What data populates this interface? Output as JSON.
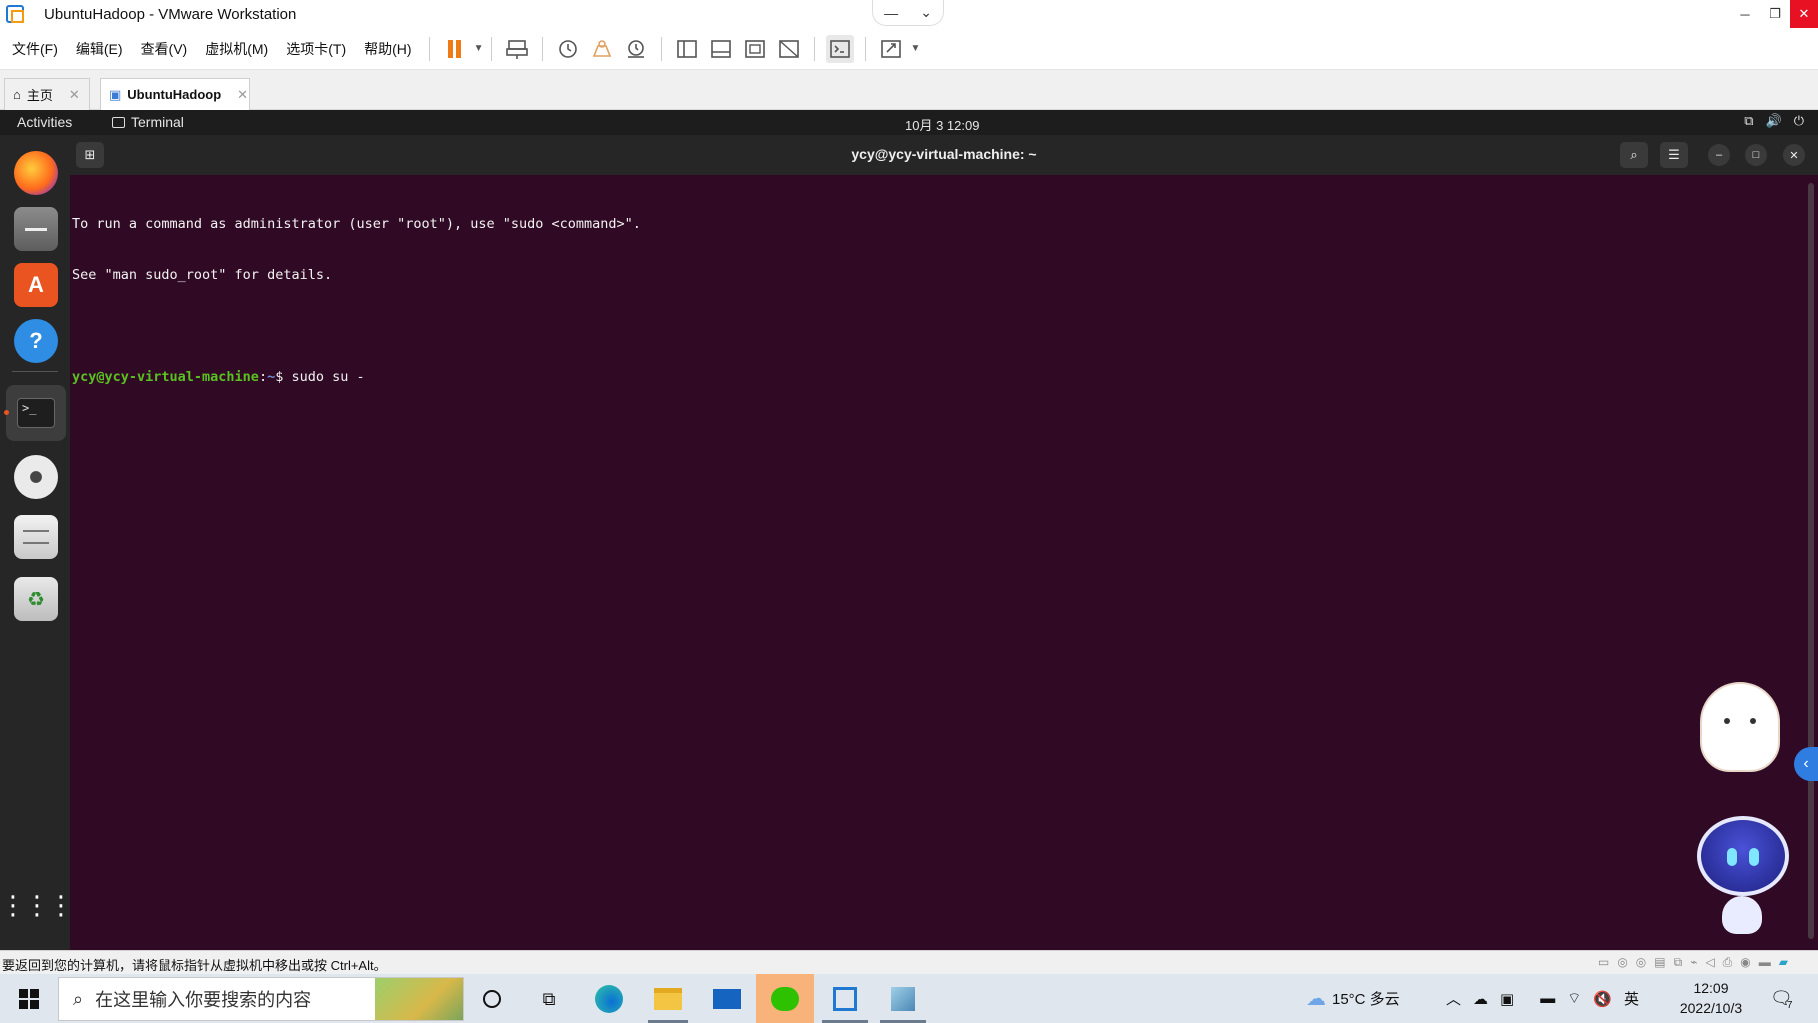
{
  "window": {
    "title": "UbuntuHadoop - VMware Workstation",
    "min_glyph": "─",
    "restore_glyph": "❐",
    "close_glyph": "✕",
    "center_min_glyph": "—",
    "center_dropdown_glyph": "⌄"
  },
  "menubar": {
    "items": [
      "文件(F)",
      "编辑(E)",
      "查看(V)",
      "虚拟机(M)",
      "选项卡(T)",
      "帮助(H)"
    ]
  },
  "tabs": [
    {
      "label": "主页",
      "icon": "home-icon"
    },
    {
      "label": "UbuntuHadoop",
      "icon": "vm-icon"
    }
  ],
  "ubuntu_topbar": {
    "activities": "Activities",
    "app_name": "Terminal",
    "clock": "10月 3  12:09"
  },
  "dock": {
    "items": [
      "firefox-icon",
      "files-icon",
      "software-icon",
      "help-icon",
      "terminal-icon",
      "disc-icon",
      "floppy-icon",
      "trash-icon",
      "app-grid-icon"
    ]
  },
  "terminal": {
    "title": "ycy@ycy-virtual-machine: ~",
    "lines": [
      "To run a command as administrator (user \"root\"), use \"sudo <command>\".",
      "See \"man sudo_root\" for details."
    ],
    "prompt_user": "ycy@ycy-virtual-machine",
    "prompt_colon": ":",
    "prompt_path": "~",
    "prompt_symbol": "$",
    "command": " sudo su -"
  },
  "statusbar": {
    "message": "要返回到您的计算机，请将鼠标指针从虚拟机中移出或按 Ctrl+Alt。"
  },
  "taskbar": {
    "search_placeholder": "在这里输入你要搜索的内容",
    "weather": "15°C  多云",
    "ime": "英",
    "time": "12:09",
    "date": "2022/10/3",
    "notification_count": "7"
  },
  "colors": {
    "terminal_bg": "#300a24",
    "prompt_user": "#59c21f",
    "prompt_path": "#6d8dd8",
    "pause_orange": "#f07a14",
    "close_red": "#e81123"
  }
}
